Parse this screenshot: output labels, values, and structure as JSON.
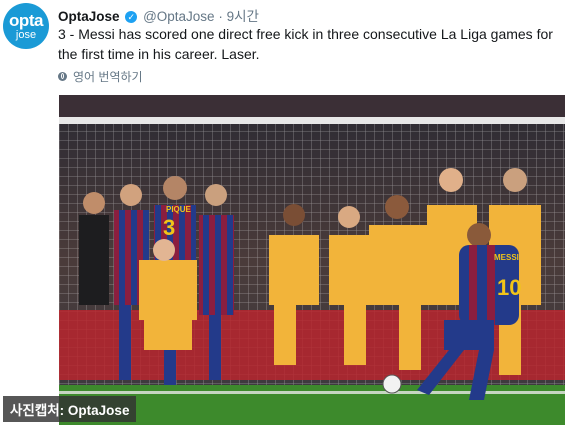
{
  "tweet": {
    "avatar_line1": "opta",
    "avatar_line2": "jose",
    "name": "OptaJose",
    "verified_glyph": "✓",
    "handle": "@OptaJose",
    "separator": "·",
    "time": "9시간",
    "text": "3 - Messi has scored one direct free kick in three consecutive La Liga games  for the first time in his career. Laser.",
    "translate_label": "영어 번역하기",
    "icons": {
      "verified": "verified-badge-icon",
      "translate": "globe-icon"
    }
  },
  "photo": {
    "jersey_number_barca": "3",
    "jersey_number_messi": "10",
    "messi_name": "MESSI",
    "player_name_pique": "PIQUE",
    "caption": "사진캡처: OptaJose"
  },
  "colors": {
    "accent": "#1da1f2",
    "avatar": "#1a9ad6",
    "pitch": "#3d8a2c",
    "atletico_yellow": "#f2b43a",
    "barca_blue": "#233a8a"
  }
}
